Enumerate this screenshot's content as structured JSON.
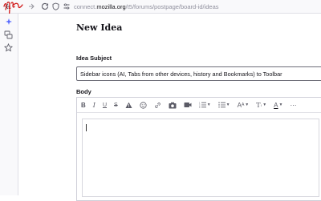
{
  "browser": {
    "url_prefix": "connect.",
    "url_host": "mozilla.org",
    "url_path": "/t5/forums/postpage/board-id/ideas",
    "icons": [
      "back-icon",
      "forward-icon",
      "reload-icon",
      "shield-icon",
      "page-icon"
    ]
  },
  "sidebar": {
    "icons": [
      "ai-sparkle-icon",
      "synced-tabs-icon",
      "bookmark-star-icon"
    ]
  },
  "form": {
    "heading": "New Idea",
    "subject_label": "Idea Subject",
    "subject_value": "Sidebar icons (AI, Tabs from other devices, history and Bookmarks) to Toolbar",
    "body_label": "Body",
    "editor_text": ""
  },
  "editor_toolbar": [
    {
      "name": "bold-icon",
      "glyph": "B"
    },
    {
      "name": "italic-icon",
      "glyph": "I"
    },
    {
      "name": "underline-icon",
      "glyph": "U"
    },
    {
      "name": "strikethrough-icon",
      "glyph": "S"
    },
    {
      "name": "spoiler-icon",
      "glyph": "⚠"
    },
    {
      "name": "emoji-icon",
      "glyph": "☺"
    },
    {
      "name": "link-icon",
      "glyph": "⛓"
    },
    {
      "name": "photo-icon",
      "glyph": "📷"
    },
    {
      "name": "video-icon",
      "glyph": "▶"
    },
    {
      "name": "numbered-list-icon",
      "glyph": "☰"
    },
    {
      "name": "bullet-list-icon",
      "glyph": "☰"
    },
    {
      "name": "font-size-icon",
      "glyph": "A"
    },
    {
      "name": "paragraph-style-icon",
      "glyph": "T"
    },
    {
      "name": "text-color-icon",
      "glyph": "A"
    },
    {
      "name": "more-icon",
      "glyph": "⋯"
    }
  ]
}
